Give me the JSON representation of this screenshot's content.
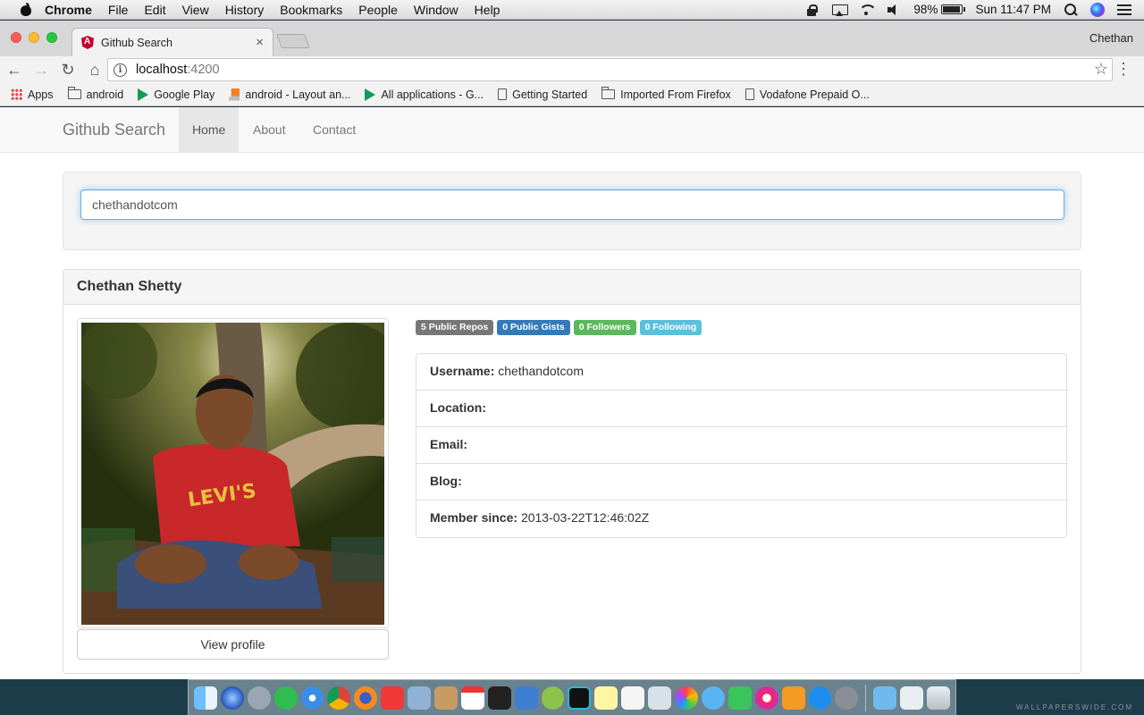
{
  "menubar": {
    "app_name": "Chrome",
    "items": [
      "File",
      "Edit",
      "View",
      "History",
      "Bookmarks",
      "People",
      "Window",
      "Help"
    ],
    "battery": "98%",
    "clock": "Sun 11:47 PM"
  },
  "browser": {
    "tab_title": "Github Search",
    "tab_close": "×",
    "profile": "Chethan",
    "url_host": "localhost",
    "url_port": ":4200",
    "back": "←",
    "forward": "→",
    "reload": "↻",
    "home": "⌂",
    "star": "☆",
    "menu": "⋮",
    "info": "i",
    "bookmarks": [
      {
        "label": "Apps",
        "icon": "apps-icon"
      },
      {
        "label": "android",
        "icon": "folder-icon"
      },
      {
        "label": "Google Play",
        "icon": "play-icon"
      },
      {
        "label": "android - Layout an...",
        "icon": "stackoverflow-icon"
      },
      {
        "label": "All applications - G...",
        "icon": "play-icon"
      },
      {
        "label": "Getting Started",
        "icon": "page-icon"
      },
      {
        "label": "Imported From Firefox",
        "icon": "folder-icon"
      },
      {
        "label": "Vodafone Prepaid O...",
        "icon": "page-icon"
      }
    ]
  },
  "app": {
    "brand": "Github Search",
    "nav": [
      "Home",
      "About",
      "Contact"
    ],
    "search_value": "chethandotcom",
    "profile": {
      "name": "Chethan Shetty",
      "view_profile": "View profile",
      "badges": [
        "5 Public Repos",
        "0 Public Gists",
        "0 Followers",
        "0 Following"
      ],
      "fields": [
        {
          "label": "Username:",
          "value": "chethandotcom"
        },
        {
          "label": "Location:",
          "value": ""
        },
        {
          "label": "Email:",
          "value": ""
        },
        {
          "label": "Blog:",
          "value": ""
        },
        {
          "label": "Member since:",
          "value": "2013-03-22T12:46:02Z"
        }
      ]
    }
  },
  "desktop": {
    "watermark": "WALLPAPERSWIDE.COM"
  },
  "colors": {
    "label_default": "#777777",
    "label_primary": "#337ab7",
    "label_success": "#5cb85c",
    "label_info": "#5bc0de",
    "focus_border": "#66afe9"
  }
}
